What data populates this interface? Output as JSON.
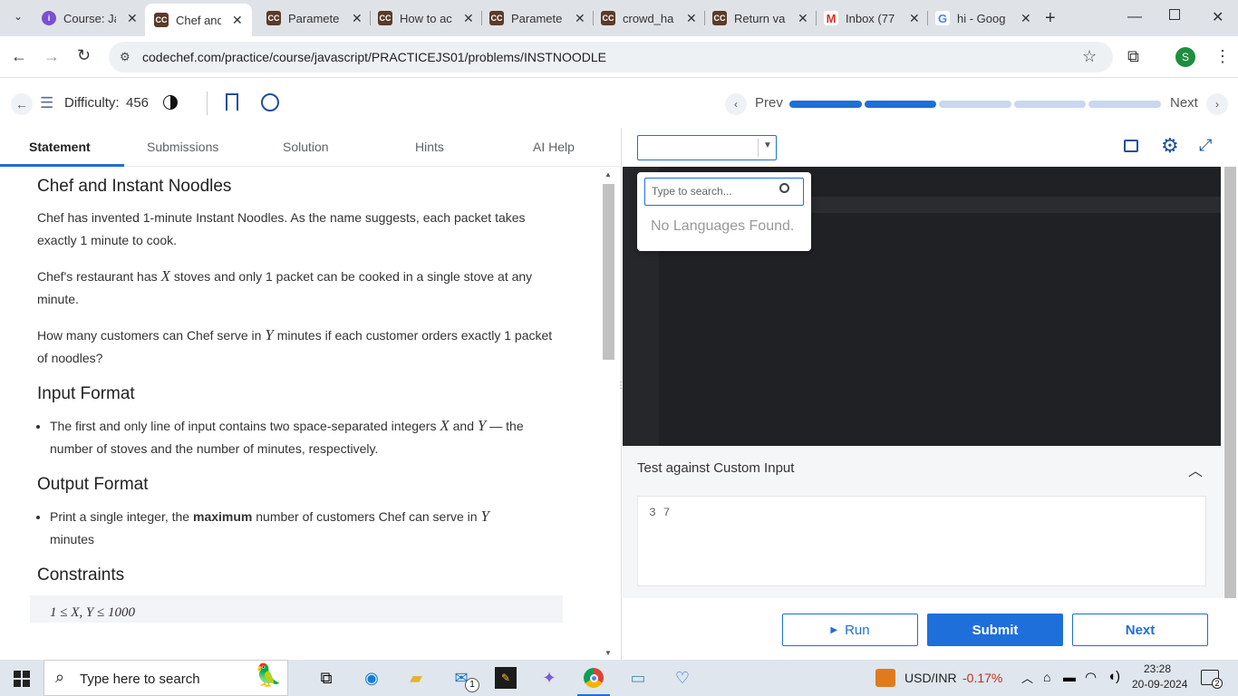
{
  "browser": {
    "tabs": [
      {
        "title": "Course: Ja",
        "icon": "course-icon"
      },
      {
        "title": "Chef and",
        "icon": "codechef-icon",
        "active": true
      },
      {
        "title": "Paramete",
        "icon": "codechef-icon"
      },
      {
        "title": "How to ac",
        "icon": "codechef-icon"
      },
      {
        "title": "Paramete",
        "icon": "codechef-icon"
      },
      {
        "title": "crowd_ha",
        "icon": "codechef-icon"
      },
      {
        "title": "Return va",
        "icon": "codechef-icon"
      },
      {
        "title": "Inbox (77",
        "icon": "gmail-icon"
      },
      {
        "title": "hi - Goog",
        "icon": "google-icon"
      }
    ],
    "url": "codechef.com/practice/course/javascript/PRACTICEJS01/problems/INSTNOODLE",
    "profile_initial": "S"
  },
  "header": {
    "difficulty_label": "Difficulty:",
    "difficulty_value": "456",
    "prev_label": "Prev",
    "next_label": "Next",
    "progress": [
      1,
      1,
      0,
      0,
      0
    ]
  },
  "problem_tabs": [
    "Statement",
    "Submissions",
    "Solution",
    "Hints",
    "AI Help"
  ],
  "problem": {
    "title": "Chef and Instant Noodles",
    "p1": "Chef has invented 1-minute Instant Noodles. As the name suggests, each packet takes exactly 1 minute to cook.",
    "p2_a": "Chef's restaurant has",
    "p2_b": "stoves and only 1 packet can be cooked in a single stove at any minute.",
    "p3_a": "How many customers can Chef serve in",
    "p3_b": "minutes if each customer orders exactly 1 packet of noodles?",
    "var_x": "X",
    "var_y": "Y",
    "input_heading": "Input Format",
    "input_a": "The first and only line of input contains two space-separated integers",
    "input_and": "and",
    "input_b": "— the number of stoves and the number of minutes, respectively.",
    "output_heading": "Output Format",
    "output_a": "Print a single integer, the",
    "output_bold": "maximum",
    "output_b": "number of customers Chef can serve in",
    "output_c": "minutes",
    "constraints_heading": "Constraints",
    "constraint_1": "1 ≤ X, Y ≤ 1000"
  },
  "language_dropdown": {
    "selected": "",
    "search_placeholder": "Type to search...",
    "empty_message": "No Languages Found."
  },
  "custom_input": {
    "heading": "Test against Custom Input",
    "value": "3 7"
  },
  "buttons": {
    "run": "Run",
    "submit": "Submit",
    "next": "Next"
  },
  "taskbar": {
    "search_placeholder": "Type here to search",
    "ticker_label": "USD/INR",
    "ticker_change": "-0.17%",
    "time": "23:28",
    "date": "20-09-2024",
    "mail_badge": "1",
    "notification_count": "2"
  },
  "colors": {
    "accent": "#1e6fd9",
    "ticker_negative": "#c42b1c"
  }
}
